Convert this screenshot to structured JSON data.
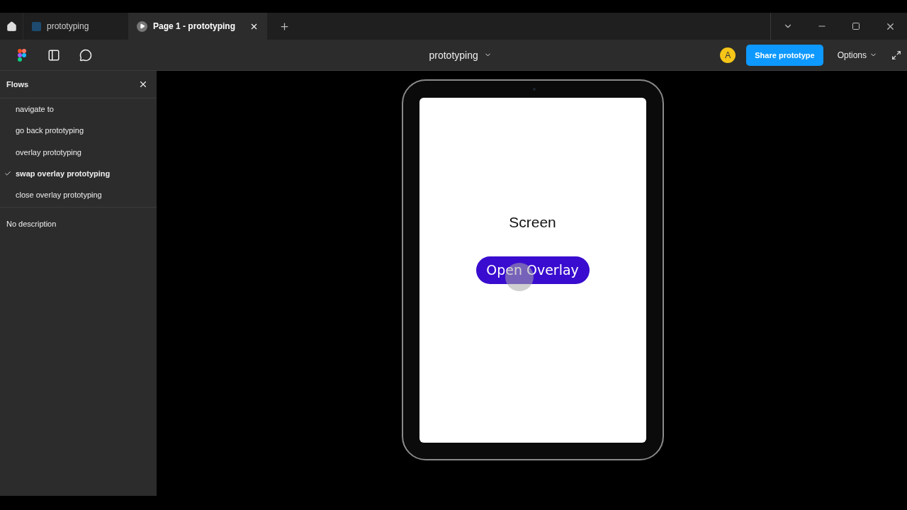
{
  "tabs": [
    {
      "label": "prototyping",
      "kind": "file",
      "selected": false
    },
    {
      "label": "Page 1 - prototyping",
      "kind": "play",
      "selected": true
    }
  ],
  "toolbar": {
    "title": "prototyping",
    "avatar": "A",
    "share_button": "Share prototype",
    "options": "Options"
  },
  "flows": {
    "title": "Flows",
    "items": [
      {
        "label": "navigate to",
        "selected": false
      },
      {
        "label": "go back prototyping",
        "selected": false
      },
      {
        "label": "overlay prototyping",
        "selected": false
      },
      {
        "label": "swap overlay prototyping",
        "selected": true
      },
      {
        "label": "close overlay prototyping",
        "selected": false
      }
    ],
    "description": "No description"
  },
  "device": {
    "heading": "Screen",
    "button": "Open Overlay"
  }
}
